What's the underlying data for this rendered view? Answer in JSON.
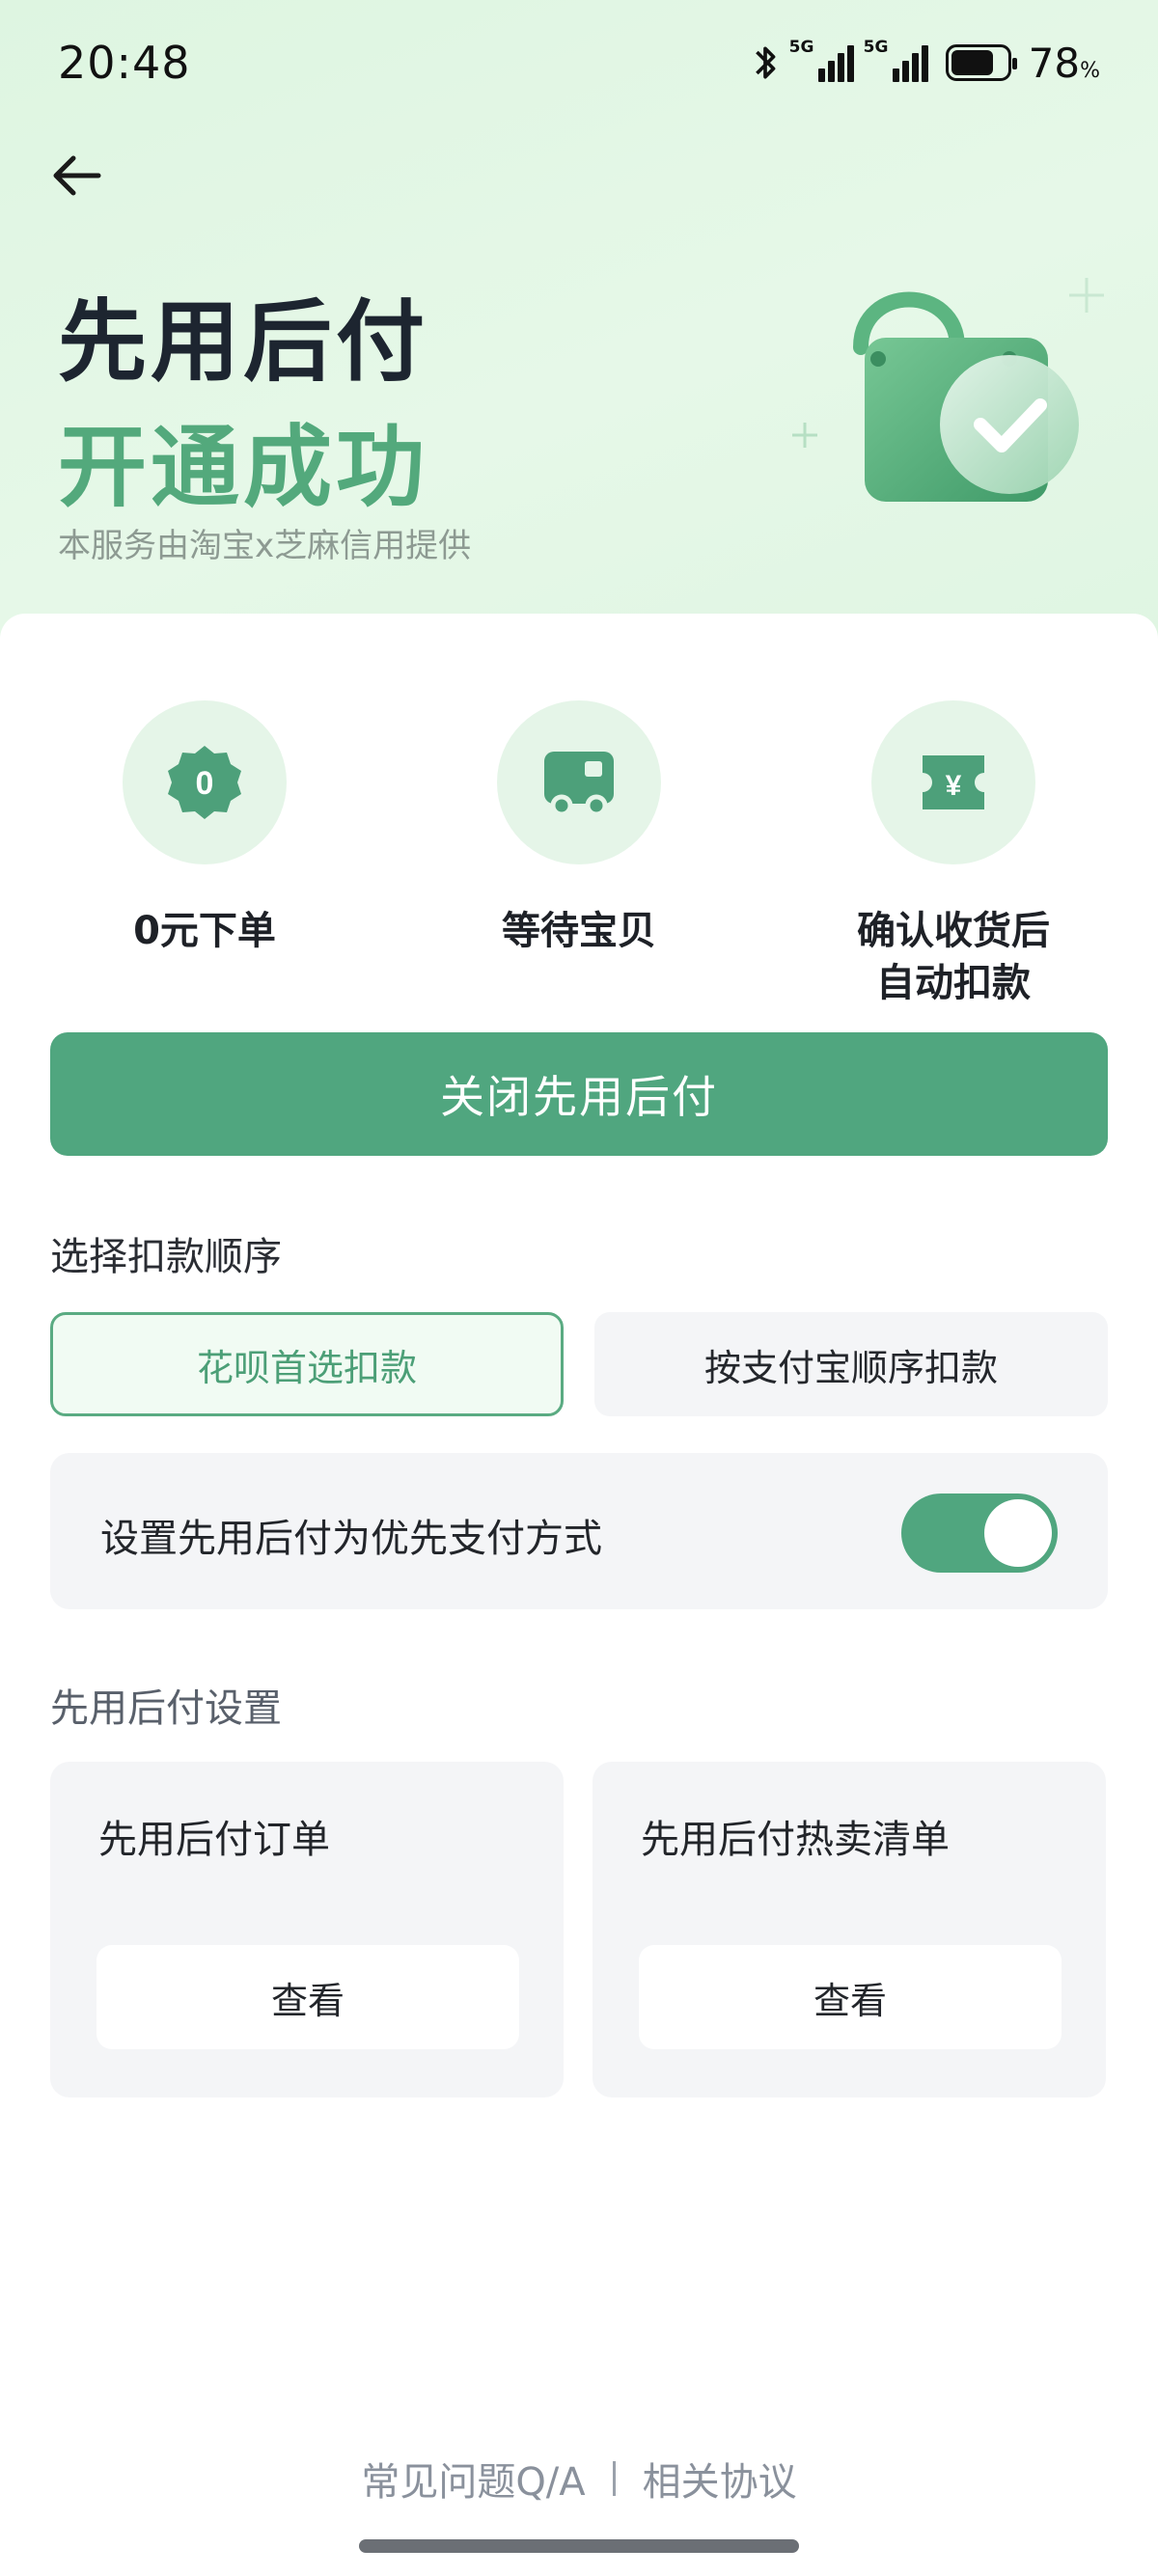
{
  "status_bar": {
    "time": "20:48",
    "network_1": "5G",
    "network_2": "5G",
    "battery_percent": "78",
    "battery_unit": "%",
    "battery_level": 0.78
  },
  "hero": {
    "title": "先用后付",
    "subtitle": "开通成功",
    "note": "本服务由淘宝x芝麻信用提供",
    "icons": [
      "shopping-bag-icon",
      "check-badge-icon"
    ]
  },
  "features": [
    {
      "icon": "zero-badge-icon",
      "badge_text": "0",
      "label": "0元下单"
    },
    {
      "icon": "delivery-truck-icon",
      "label": "等待宝贝"
    },
    {
      "icon": "yuan-ticket-icon",
      "badge_text": "¥",
      "label_line1": "确认收货后",
      "label_line2": "自动扣款"
    }
  ],
  "close_button": "关闭先用后付",
  "deduction": {
    "label": "选择扣款顺序",
    "options": [
      {
        "label": "花呗首选扣款",
        "selected": true
      },
      {
        "label": "按支付宝顺序扣款",
        "selected": false
      }
    ]
  },
  "priority_toggle": {
    "label": "设置先用后付为优先支付方式",
    "on": true
  },
  "settings": {
    "label": "先用后付设置",
    "tiles": [
      {
        "title": "先用后付订单",
        "button": "查看"
      },
      {
        "title": "先用后付热卖清单",
        "button": "查看"
      }
    ]
  },
  "footer": {
    "faq": "常见问题Q/A",
    "agreement": "相关协议"
  },
  "colors": {
    "accent": "#50a67f",
    "accent_text": "#53a97c",
    "hero_bg": "#e0f6e3",
    "icon_circle": "#e5f5e8"
  }
}
